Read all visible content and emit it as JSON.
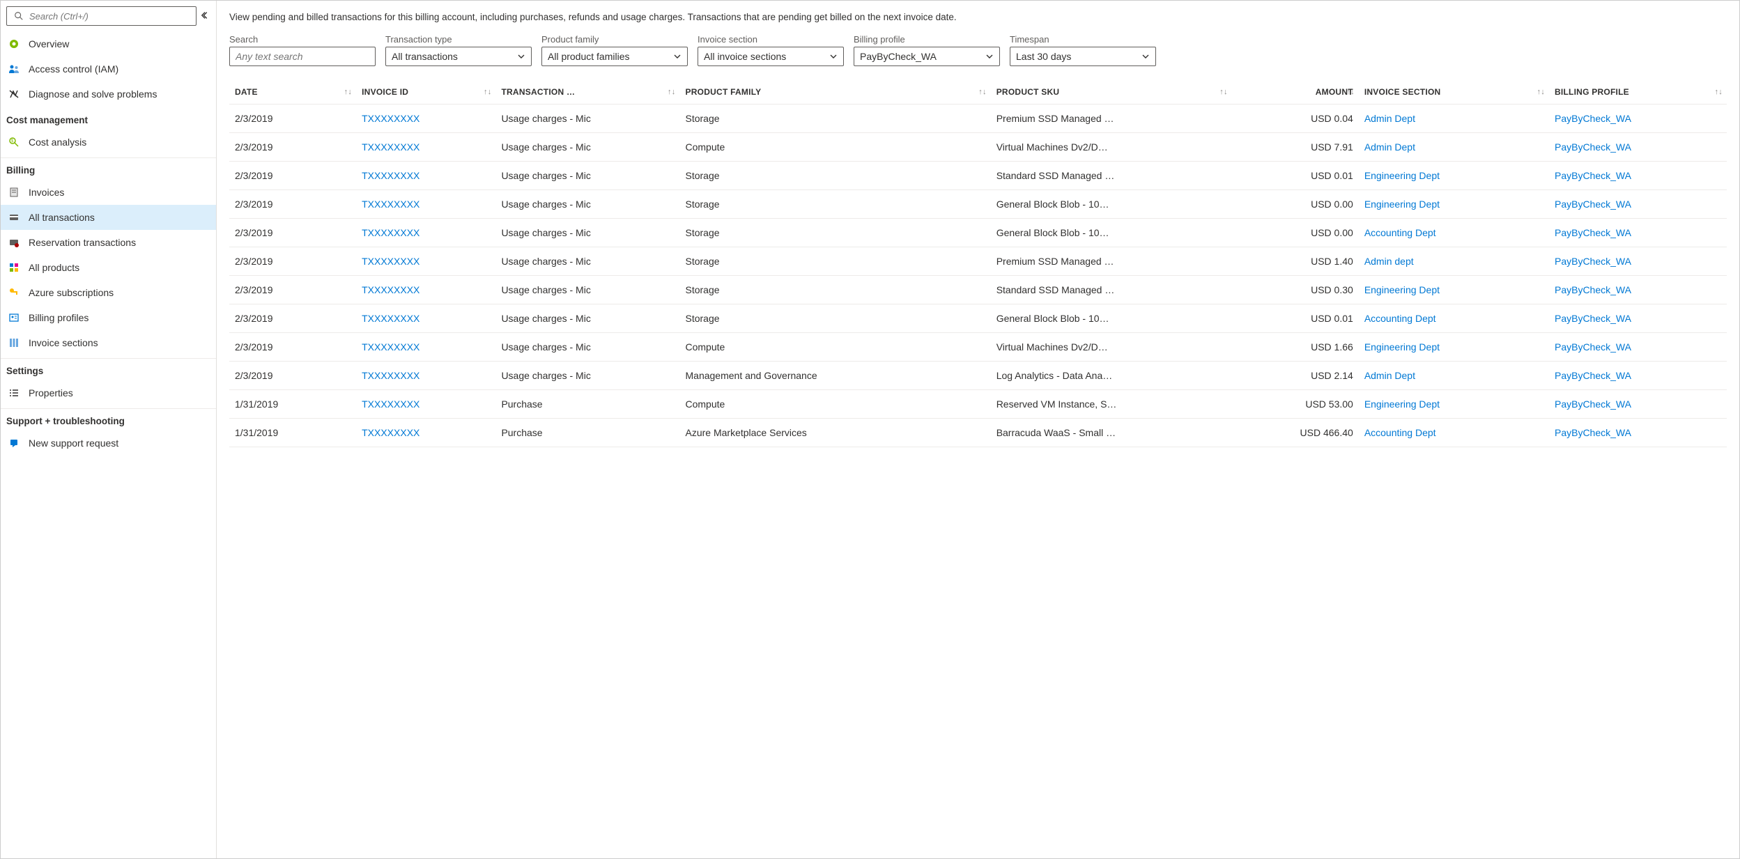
{
  "sidebar": {
    "search_placeholder": "Search (Ctrl+/)",
    "top": [
      {
        "label": "Overview",
        "icon": "overview"
      },
      {
        "label": "Access control (IAM)",
        "icon": "iam"
      },
      {
        "label": "Diagnose and solve problems",
        "icon": "diagnose"
      }
    ],
    "sections": [
      {
        "header": "Cost management",
        "items": [
          {
            "label": "Cost analysis",
            "icon": "cost"
          }
        ]
      },
      {
        "header": "Billing",
        "items": [
          {
            "label": "Invoices",
            "icon": "invoices"
          },
          {
            "label": "All transactions",
            "icon": "transactions",
            "active": true
          },
          {
            "label": "Reservation transactions",
            "icon": "reservation"
          },
          {
            "label": "All products",
            "icon": "products"
          },
          {
            "label": "Azure subscriptions",
            "icon": "key"
          },
          {
            "label": "Billing profiles",
            "icon": "profiles"
          },
          {
            "label": "Invoice sections",
            "icon": "sections"
          }
        ]
      },
      {
        "header": "Settings",
        "items": [
          {
            "label": "Properties",
            "icon": "properties"
          }
        ]
      },
      {
        "header": "Support + troubleshooting",
        "items": [
          {
            "label": "New support request",
            "icon": "support"
          }
        ]
      }
    ]
  },
  "main": {
    "description": "View pending and billed transactions for this billing account, including purchases, refunds and usage charges. Transactions that are pending get billed on the next invoice date.",
    "filters": {
      "search": {
        "label": "Search",
        "placeholder": "Any text search"
      },
      "transaction_type": {
        "label": "Transaction type",
        "value": "All transactions"
      },
      "product_family": {
        "label": "Product family",
        "value": "All product families"
      },
      "invoice_section": {
        "label": "Invoice section",
        "value": "All invoice sections"
      },
      "billing_profile": {
        "label": "Billing profile",
        "value": "PayByCheck_WA"
      },
      "timespan": {
        "label": "Timespan",
        "value": "Last 30 days"
      }
    },
    "columns": [
      "DATE",
      "INVOICE ID",
      "TRANSACTION …",
      "PRODUCT FAMILY",
      "PRODUCT SKU",
      "AMOUNT",
      "INVOICE SECTION",
      "BILLING PROFILE"
    ],
    "rows": [
      {
        "date": "2/3/2019",
        "invoice": "TXXXXXXXX",
        "tt": "Usage charges - Mic",
        "pf": "Storage",
        "sku": "Premium SSD Managed …",
        "amt": "USD 0.04",
        "sec": "Admin Dept",
        "bp": "PayByCheck_WA"
      },
      {
        "date": "2/3/2019",
        "invoice": "TXXXXXXXX",
        "tt": "Usage charges - Mic",
        "pf": "Compute",
        "sku": "Virtual Machines Dv2/D…",
        "amt": "USD 7.91",
        "sec": "Admin Dept",
        "bp": "PayByCheck_WA"
      },
      {
        "date": "2/3/2019",
        "invoice": "TXXXXXXXX",
        "tt": "Usage charges - Mic",
        "pf": "Storage",
        "sku": "Standard SSD Managed …",
        "amt": "USD 0.01",
        "sec": "Engineering Dept",
        "bp": "PayByCheck_WA"
      },
      {
        "date": "2/3/2019",
        "invoice": "TXXXXXXXX",
        "tt": "Usage charges - Mic",
        "pf": "Storage",
        "sku": "General Block Blob - 10…",
        "amt": "USD 0.00",
        "sec": "Engineering Dept",
        "bp": "PayByCheck_WA"
      },
      {
        "date": "2/3/2019",
        "invoice": "TXXXXXXXX",
        "tt": "Usage charges - Mic",
        "pf": "Storage",
        "sku": "General Block Blob - 10…",
        "amt": "USD 0.00",
        "sec": "Accounting Dept",
        "bp": "PayByCheck_WA"
      },
      {
        "date": "2/3/2019",
        "invoice": "TXXXXXXXX",
        "tt": "Usage charges - Mic",
        "pf": "Storage",
        "sku": "Premium SSD Managed …",
        "amt": "USD 1.40",
        "sec": "Admin dept",
        "bp": "PayByCheck_WA"
      },
      {
        "date": "2/3/2019",
        "invoice": "TXXXXXXXX",
        "tt": "Usage charges - Mic",
        "pf": "Storage",
        "sku": "Standard SSD Managed …",
        "amt": "USD 0.30",
        "sec": "Engineering Dept",
        "bp": "PayByCheck_WA"
      },
      {
        "date": "2/3/2019",
        "invoice": "TXXXXXXXX",
        "tt": "Usage charges - Mic",
        "pf": "Storage",
        "sku": "General Block Blob - 10…",
        "amt": "USD 0.01",
        "sec": "Accounting Dept",
        "bp": "PayByCheck_WA"
      },
      {
        "date": "2/3/2019",
        "invoice": "TXXXXXXXX",
        "tt": "Usage charges - Mic",
        "pf": "Compute",
        "sku": "Virtual Machines Dv2/D…",
        "amt": "USD 1.66",
        "sec": "Engineering Dept",
        "bp": "PayByCheck_WA"
      },
      {
        "date": "2/3/2019",
        "invoice": "TXXXXXXXX",
        "tt": "Usage charges - Mic",
        "pf": "Management and Governance",
        "sku": "Log Analytics - Data Ana…",
        "amt": "USD 2.14",
        "sec": "Admin Dept",
        "bp": "PayByCheck_WA"
      },
      {
        "date": "1/31/2019",
        "invoice": "TXXXXXXXX",
        "tt": "Purchase",
        "pf": "Compute",
        "sku": "Reserved VM Instance, S…",
        "amt": "USD 53.00",
        "sec": "Engineering Dept",
        "bp": "PayByCheck_WA"
      },
      {
        "date": "1/31/2019",
        "invoice": "TXXXXXXXX",
        "tt": "Purchase",
        "pf": "Azure Marketplace Services",
        "sku": "Barracuda WaaS - Small …",
        "amt": "USD 466.40",
        "sec": "Accounting Dept",
        "bp": "PayByCheck_WA"
      }
    ]
  }
}
